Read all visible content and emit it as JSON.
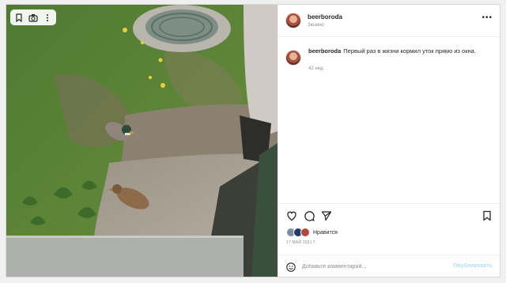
{
  "post": {
    "username": "beerboroda",
    "location": "Зюзино",
    "caption_username": "beerboroda",
    "caption_text": "Первый раз в жизни кормил уток прямо из окна.",
    "age": "42 нед.",
    "likes_label": "Нравится",
    "date": "17 МАЙ 2021 Г.",
    "comment_placeholder": "Добавьте комментарий...",
    "publish_label": "Опубликовать"
  },
  "icons": {
    "bookmark": "bookmark-icon",
    "camera": "camera-icon",
    "more": "more-icon",
    "heart": "heart-icon",
    "comment": "comment-icon",
    "share": "share-icon",
    "save": "save-icon",
    "emoji": "emoji-icon"
  },
  "colors": {
    "publish_disabled": "#b2dffc",
    "text_primary": "#262626",
    "text_secondary": "#8e8e8e"
  }
}
